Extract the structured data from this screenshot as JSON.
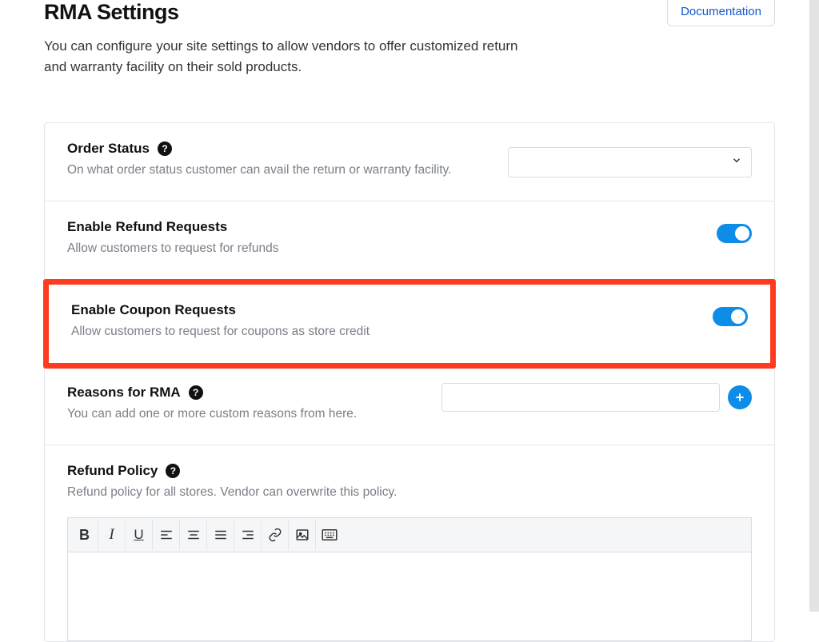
{
  "header": {
    "title": "RMA Settings",
    "description": "You can configure your site settings to allow vendors to offer customized return and warranty facility on their sold products.",
    "doc_button": "Documentation"
  },
  "settings": {
    "order_status": {
      "label": "Order Status",
      "desc": "On what order status customer can avail the return or warranty facility.",
      "selected": ""
    },
    "refund_requests": {
      "label": "Enable Refund Requests",
      "desc": "Allow customers to request for refunds",
      "enabled": true
    },
    "coupon_requests": {
      "label": "Enable Coupon Requests",
      "desc": "Allow customers to request for coupons as store credit",
      "enabled": true
    },
    "reasons": {
      "label": "Reasons for RMA",
      "desc": "You can add one or more custom reasons from here.",
      "input_value": ""
    },
    "refund_policy": {
      "label": "Refund Policy",
      "desc": "Refund policy for all stores. Vendor can overwrite this policy.",
      "content": ""
    }
  },
  "icons": {
    "help": "?",
    "plus": "+"
  }
}
